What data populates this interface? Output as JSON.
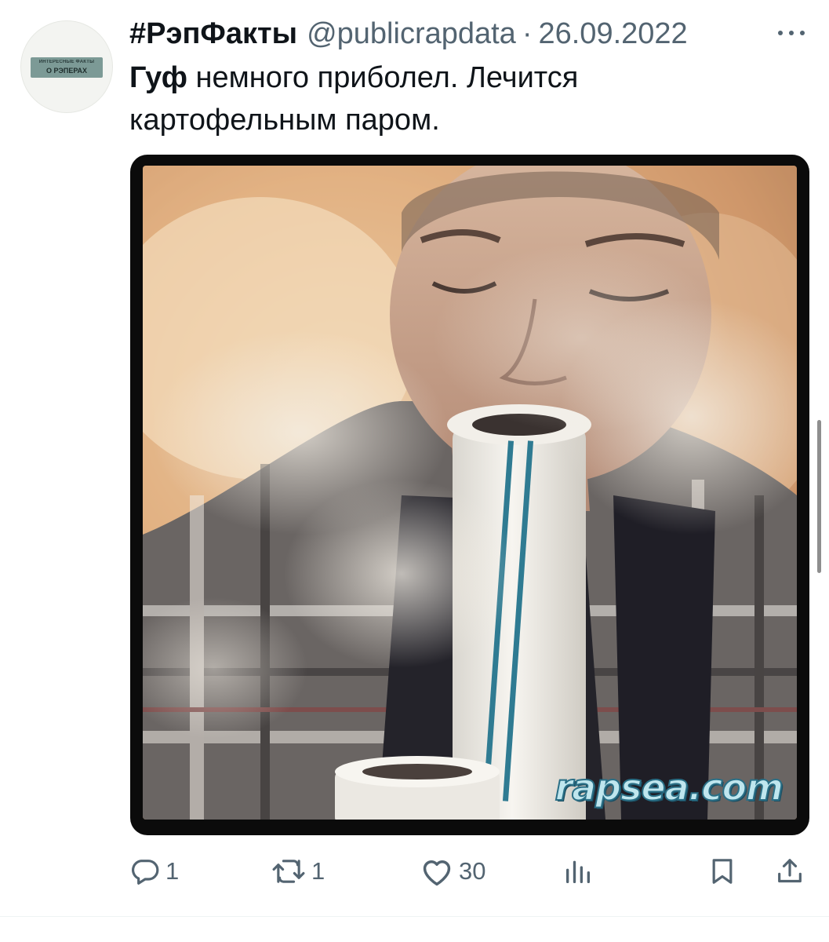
{
  "tweet": {
    "author": {
      "display_name": "#РэпФакты",
      "handle": "@publicrapdata",
      "avatar_label_small": "ИНТЕРЕСНЫЕ ФАКТЫ",
      "avatar_label": "О РЭПЕРАХ"
    },
    "separator": "·",
    "date": "26.09.2022",
    "text": {
      "bold": "Гуф",
      "rest": " немного приболел. Лечится картофельным паром."
    },
    "media": {
      "watermark": "rapsea.com"
    },
    "actions": {
      "reply_count": "1",
      "retweet_count": "1",
      "like_count": "30"
    },
    "icons": {
      "more": "more-icon",
      "reply": "reply-icon",
      "retweet": "retweet-icon",
      "like": "like-icon",
      "views": "views-icon",
      "bookmark": "bookmark-icon",
      "share": "share-icon"
    },
    "colors": {
      "text": "#0f1419",
      "secondary": "#536471",
      "media_frame": "#0b0b0b"
    }
  }
}
